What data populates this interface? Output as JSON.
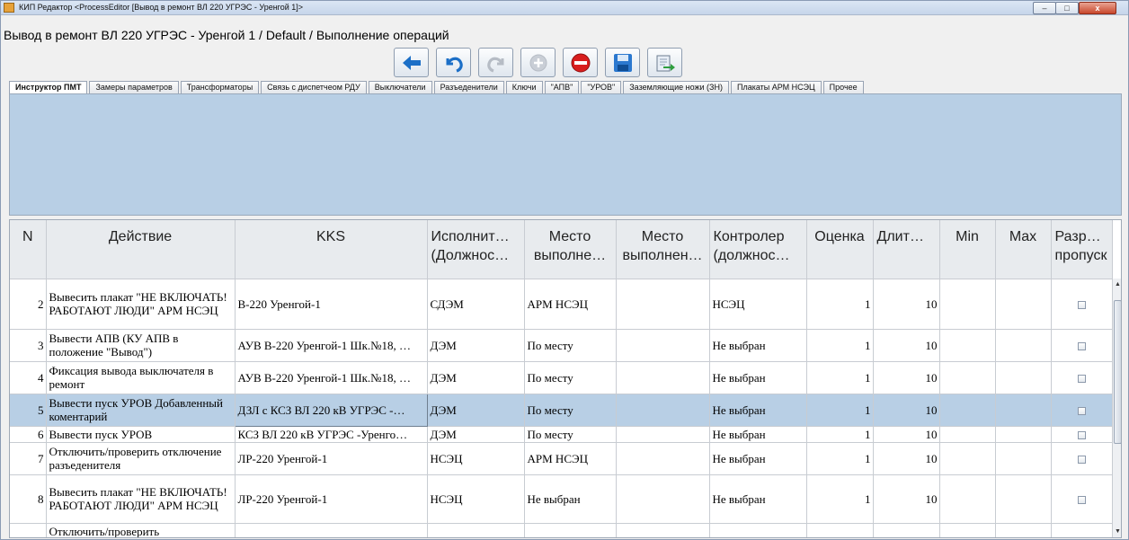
{
  "window": {
    "title": "КИП Редактор <ProcessEditor [Вывод в ремонт ВЛ 220 УГРЭС - Уренгой 1]>",
    "min_label": "‒",
    "max_label": "□",
    "close_label": "x"
  },
  "breadcrumb": "Вывод в ремонт ВЛ 220 УГРЭС - Уренгой 1 / Default /   Выполнение операций",
  "toolbar": {
    "icons": [
      "back-arrow-icon",
      "undo-icon",
      "redo-icon",
      "add-circle-icon",
      "stop-icon",
      "save-disk-icon",
      "export-icon"
    ],
    "colors": {
      "blue": "#1c6fc7",
      "red": "#d81e1e",
      "disabled": "#b6bcc5"
    }
  },
  "tabs": [
    "Инструктор ПМТ",
    "Замеры параметров",
    "Трансформаторы",
    "Связь с диспетчеом РДУ",
    "Выключатели",
    "Разъеденители",
    "Ключи",
    "\"АПВ\"",
    "\"УРОВ\"",
    "Заземляющие ножи (ЗН)",
    "Плакаты АРМ НСЭЦ",
    "Прочее"
  ],
  "grid": {
    "headers": {
      "n": "N",
      "action": "Действие",
      "kks": "KKS",
      "executor_1": "Исполнит…",
      "executor_2": "(Должнос…",
      "place_1": "Место",
      "place_2": "выполне…",
      "place2_1": "Место",
      "place2_2": "выполнен…",
      "controller_1": "Контролер",
      "controller_2": "(должнос…",
      "rating": "Оценка",
      "duration": "Длит…",
      "min": "Min",
      "max": "Max",
      "skip_1": "Разре…",
      "skip_2": "пропуск"
    },
    "rows": [
      {
        "n": "2",
        "action": "Вывесить плакат \"НЕ ВКЛЮЧАТЬ! РАБОТАЮТ ЛЮДИ\" АРМ НСЭЦ",
        "kks": "В-220 Уренгой-1",
        "executor": "СДЭМ",
        "place": "АРМ НСЭЦ",
        "place2": "",
        "controller": "НСЭЦ",
        "rating": "1",
        "duration": "10",
        "min": "",
        "max": ""
      },
      {
        "n": "3",
        "action": "Вывести АПВ  (КУ АПВ в положение \"Вывод\")",
        "kks": "АУВ В-220 Уренгой-1 Шк.№18, …",
        "executor": "ДЭМ",
        "place": "По месту",
        "place2": "",
        "controller": "Не выбран",
        "rating": "1",
        "duration": "10",
        "min": "",
        "max": ""
      },
      {
        "n": "4",
        "action": "Фиксация вывода выключателя в ремонт",
        "kks": "АУВ В-220 Уренгой-1 Шк.№18, …",
        "executor": "ДЭМ",
        "place": "По месту",
        "place2": "",
        "controller": "Не выбран",
        "rating": "1",
        "duration": "10",
        "min": "",
        "max": ""
      },
      {
        "n": "5",
        "action": "Вывести пуск УРОВ Добавленный коментарий",
        "kks": "ДЗЛ с КСЗ ВЛ 220 кВ УГРЭС -…",
        "executor": "ДЭМ",
        "place": "По месту",
        "place2": "",
        "controller": "Не выбран",
        "rating": "1",
        "duration": "10",
        "min": "",
        "max": ""
      },
      {
        "n": "6",
        "action": "Вывести пуск УРОВ",
        "kks": "КСЗ ВЛ 220 кВ УГРЭС -Уренго…",
        "executor": "ДЭМ",
        "place": "По месту",
        "place2": "",
        "controller": "Не выбран",
        "rating": "1",
        "duration": "10",
        "min": "",
        "max": ""
      },
      {
        "n": "7",
        "action": "Отключить/проверить отключение разъеденителя",
        "kks": "ЛР-220 Уренгой-1",
        "executor": "НСЭЦ",
        "place": "АРМ НСЭЦ",
        "place2": "",
        "controller": "Не выбран",
        "rating": "1",
        "duration": "10",
        "min": "",
        "max": ""
      },
      {
        "n": "8",
        "action": "Вывесить плакат \"НЕ ВКЛЮЧАТЬ! РАБОТАЮТ ЛЮДИ\" АРМ НСЭЦ",
        "kks": "ЛР-220 Уренгой-1",
        "executor": "НСЭЦ",
        "place": "Не выбран",
        "place2": "",
        "controller": "Не выбран",
        "rating": "1",
        "duration": "10",
        "min": "",
        "max": ""
      },
      {
        "n": "",
        "action": "Отключить/проверить",
        "kks": "",
        "executor": "",
        "place": "",
        "place2": "",
        "controller": "",
        "rating": "",
        "duration": "",
        "min": "",
        "max": ""
      }
    ],
    "selected_row_index": 3
  },
  "scrollbar": {
    "up": "▲",
    "down": "▼"
  }
}
